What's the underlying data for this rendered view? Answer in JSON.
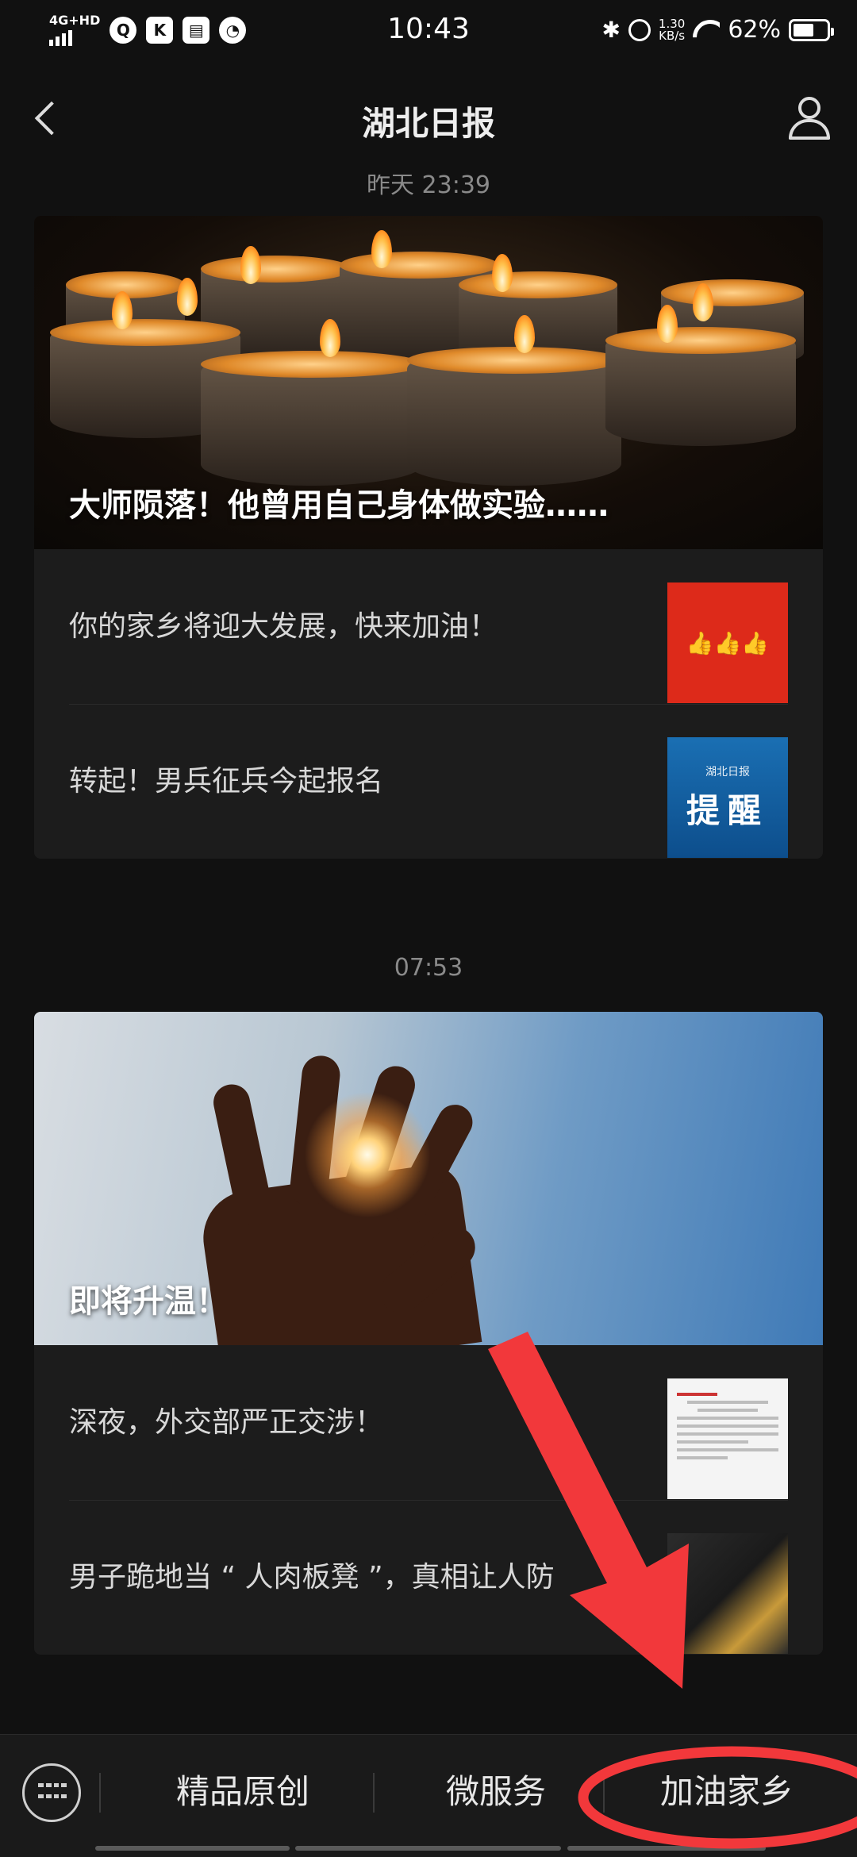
{
  "status_bar": {
    "network": "4G+HD",
    "app_k": "K",
    "time": "10:43",
    "speed_value": "1.30",
    "speed_unit": "KB/s",
    "battery": "62%",
    "battery_level": 0.62
  },
  "header": {
    "title": "湖北日报"
  },
  "feed": {
    "groups": [
      {
        "time": "昨天 23:39",
        "hero_title": "大师陨落！他曾用自己身体做实验……",
        "items": [
          {
            "title": "你的家乡将迎大发展，快来加油！",
            "thumb_text": "👍👍👍"
          },
          {
            "title": "转起！男兵征兵今起报名",
            "thumb_small": "湖北日报",
            "thumb_big": "提醒"
          }
        ]
      },
      {
        "time": "07:53",
        "hero_title": "即将升温！",
        "items": [
          {
            "title": "深夜，外交部严正交涉！"
          },
          {
            "title": "男子跪地当 “ 人肉板凳 ”，真相让人防"
          }
        ]
      }
    ]
  },
  "bottom_menu": {
    "tabs": [
      "精品原创",
      "微服务",
      "加油家乡"
    ]
  },
  "colors": {
    "annotation_red": "#f2383b"
  }
}
